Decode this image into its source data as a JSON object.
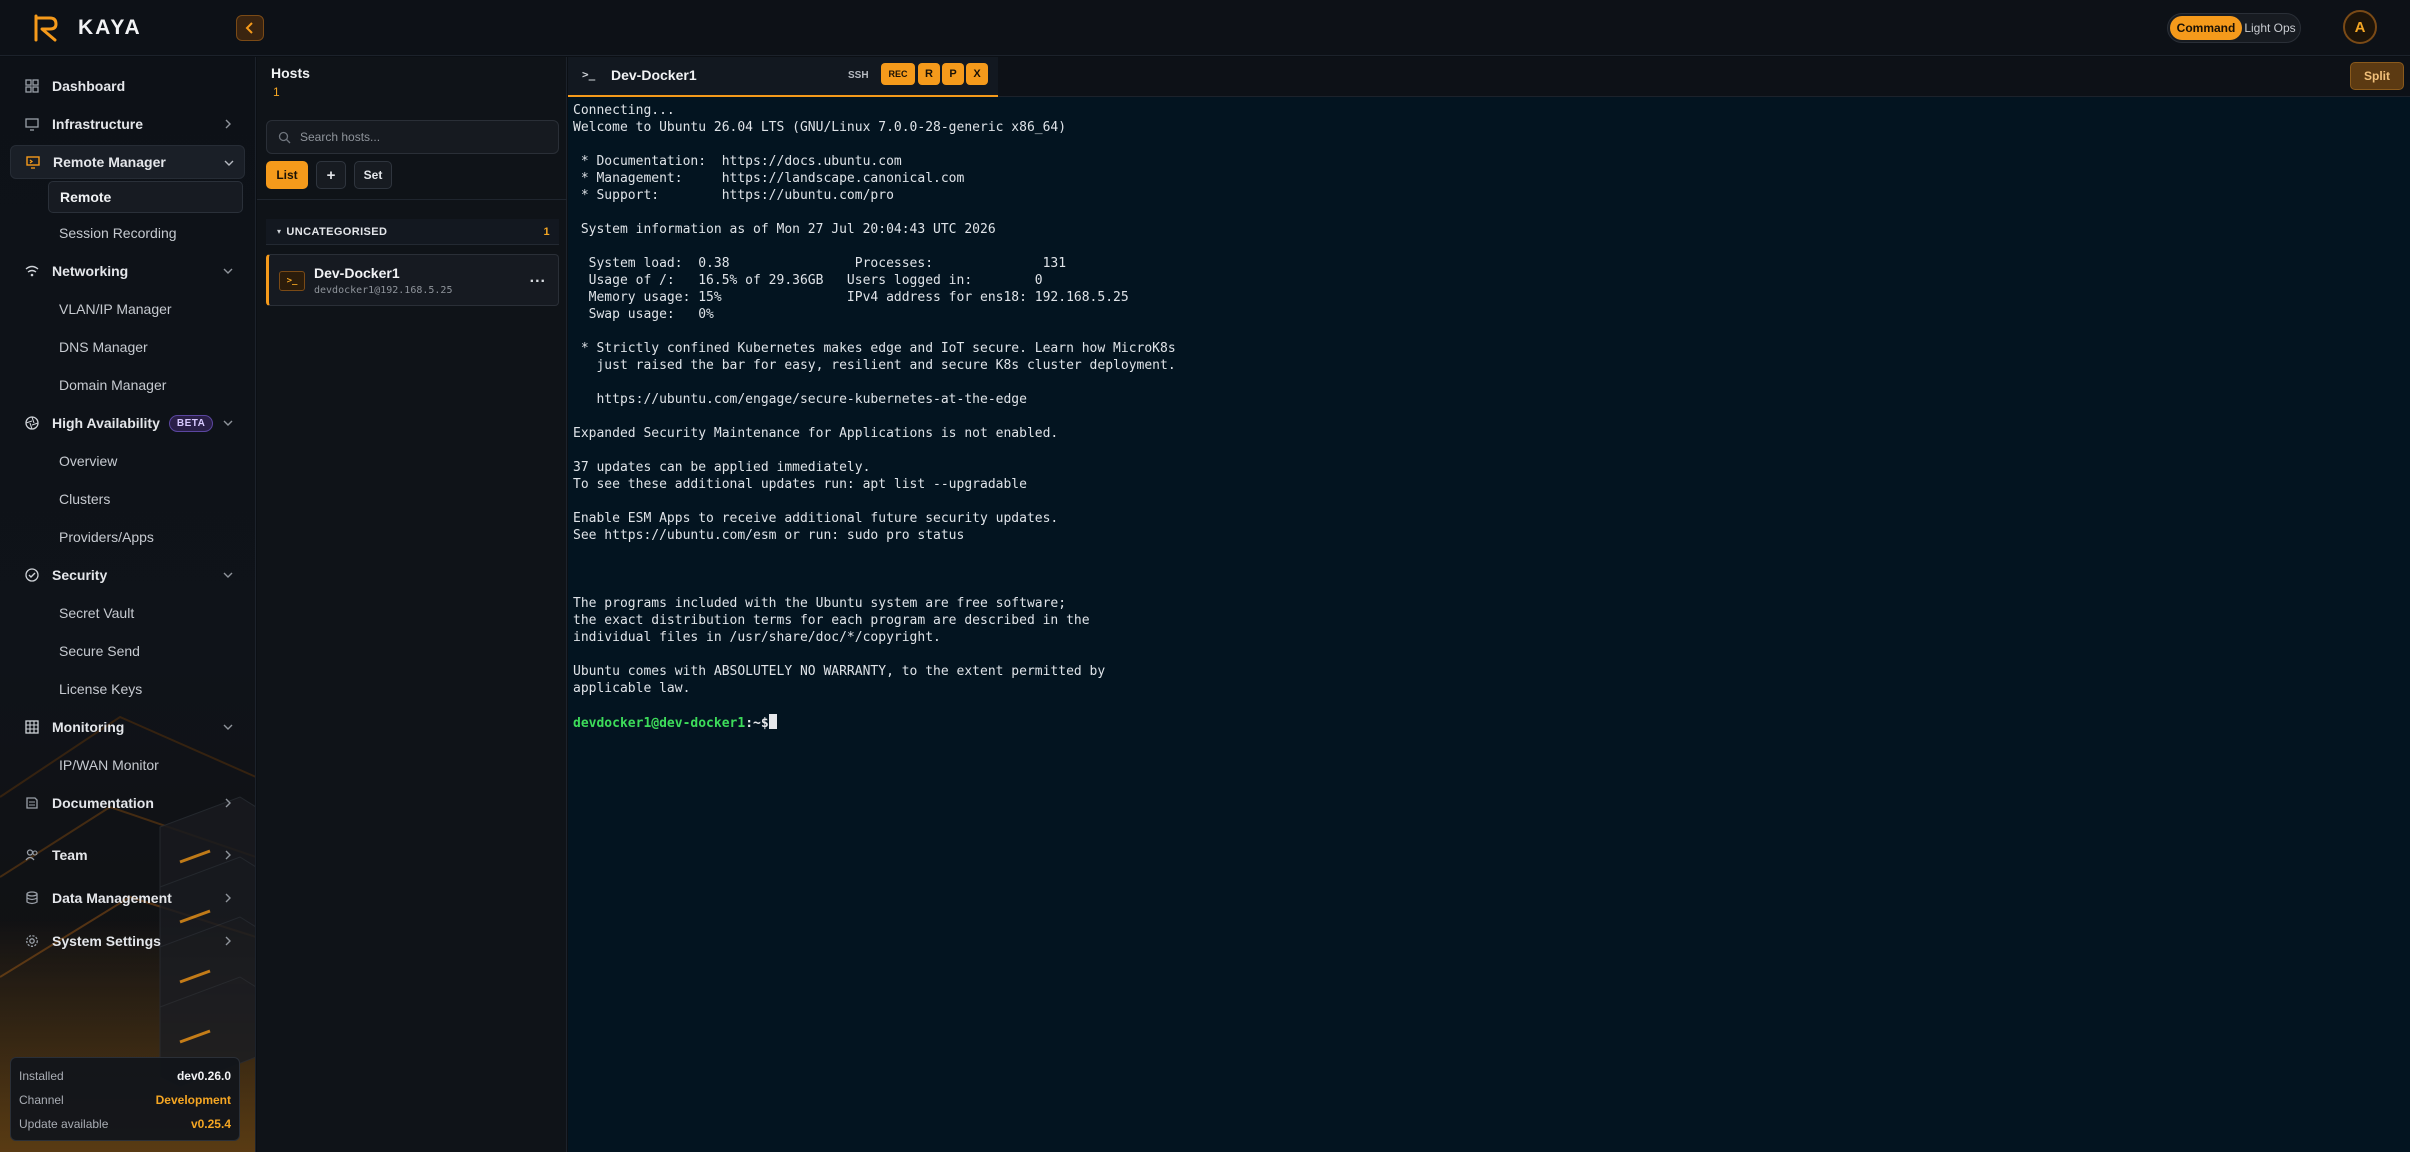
{
  "app": {
    "brand": "KAYA",
    "modes": [
      "Command",
      "Light Ops"
    ],
    "active_mode": "Command",
    "avatar_initial": "A",
    "accent_color": "#f59a1b"
  },
  "sidebar": {
    "items": [
      {
        "id": "dashboard",
        "label": "Dashboard",
        "icon": "dashboard-icon"
      },
      {
        "id": "infrastructure",
        "label": "Infrastructure",
        "icon": "monitor-icon"
      },
      {
        "id": "remote-manager",
        "label": "Remote Manager",
        "icon": "remote-icon"
      },
      {
        "id": "remote",
        "label": "Remote"
      },
      {
        "id": "session-recording",
        "label": "Session Recording"
      },
      {
        "id": "networking",
        "label": "Networking",
        "icon": "wifi-icon"
      },
      {
        "id": "vlan-ip-manager",
        "label": "VLAN/IP Manager"
      },
      {
        "id": "dns-manager",
        "label": "DNS Manager"
      },
      {
        "id": "domain-manager",
        "label": "Domain Manager"
      },
      {
        "id": "high-availability",
        "label": "High Availability",
        "icon": "aperture-icon",
        "badge": "BETA"
      },
      {
        "id": "overview",
        "label": "Overview"
      },
      {
        "id": "clusters",
        "label": "Clusters"
      },
      {
        "id": "providers-apps",
        "label": "Providers/Apps"
      },
      {
        "id": "security",
        "label": "Security",
        "icon": "shield-check-icon"
      },
      {
        "id": "secret-vault",
        "label": "Secret Vault"
      },
      {
        "id": "secure-send",
        "label": "Secure Send"
      },
      {
        "id": "license-keys",
        "label": "License Keys"
      },
      {
        "id": "monitoring",
        "label": "Monitoring",
        "icon": "grid-icon"
      },
      {
        "id": "ip-wan-monitor",
        "label": "IP/WAN Monitor"
      },
      {
        "id": "documentation",
        "label": "Documentation",
        "icon": "book-icon"
      },
      {
        "id": "team",
        "label": "Team",
        "icon": "users-icon"
      },
      {
        "id": "data-management",
        "label": "Data Management",
        "icon": "database-icon"
      },
      {
        "id": "system-settings",
        "label": "System Settings",
        "icon": "gear-icon"
      }
    ],
    "version": {
      "installed_label": "Installed",
      "installed_value": "dev0.26.0",
      "channel_label": "Channel",
      "channel_value": "Development",
      "update_label": "Update available",
      "update_value": "v0.25.4"
    }
  },
  "hosts": {
    "title": "Hosts",
    "count": "1",
    "search_placeholder": "Search hosts...",
    "buttons": {
      "list": "List",
      "add": "+",
      "set": "Set"
    },
    "group": {
      "name": "UNCATEGORISED",
      "count": "1"
    },
    "items": [
      {
        "name": "Dev-Docker1",
        "address": "devdocker1@192.168.5.25",
        "more": "..."
      }
    ]
  },
  "terminal": {
    "tab": {
      "icon_text": ">_",
      "title": "Dev-Docker1",
      "protocol": "SSH",
      "buttons": [
        "REC",
        "R",
        "P",
        "X"
      ]
    },
    "split_label": "Split",
    "lines": [
      "Connecting...",
      "Welcome to Ubuntu 26.04 LTS (GNU/Linux 7.0.0-28-generic x86_64)",
      "",
      " * Documentation:  https://docs.ubuntu.com",
      " * Management:     https://landscape.canonical.com",
      " * Support:        https://ubuntu.com/pro",
      "",
      " System information as of Mon 27 Jul 20:04:43 UTC 2026",
      "",
      "  System load:  0.38                Processes:              131",
      "  Usage of /:   16.5% of 29.36GB   Users logged in:        0",
      "  Memory usage: 15%                IPv4 address for ens18: 192.168.5.25",
      "  Swap usage:   0%",
      "",
      " * Strictly confined Kubernetes makes edge and IoT secure. Learn how MicroK8s",
      "   just raised the bar for easy, resilient and secure K8s cluster deployment.",
      "",
      "   https://ubuntu.com/engage/secure-kubernetes-at-the-edge",
      "",
      "Expanded Security Maintenance for Applications is not enabled.",
      "",
      "37 updates can be applied immediately.",
      "To see these additional updates run: apt list --upgradable",
      "",
      "Enable ESM Apps to receive additional future security updates.",
      "See https://ubuntu.com/esm or run: sudo pro status",
      "",
      "",
      "",
      "The programs included with the Ubuntu system are free software;",
      "the exact distribution terms for each program are described in the",
      "individual files in /usr/share/doc/*/copyright.",
      "",
      "Ubuntu comes with ABSOLUTELY NO WARRANTY, to the extent permitted by",
      "applicable law.",
      ""
    ],
    "prompt_user": "devdocker1@dev-docker1",
    "prompt_suffix": ":~$"
  }
}
